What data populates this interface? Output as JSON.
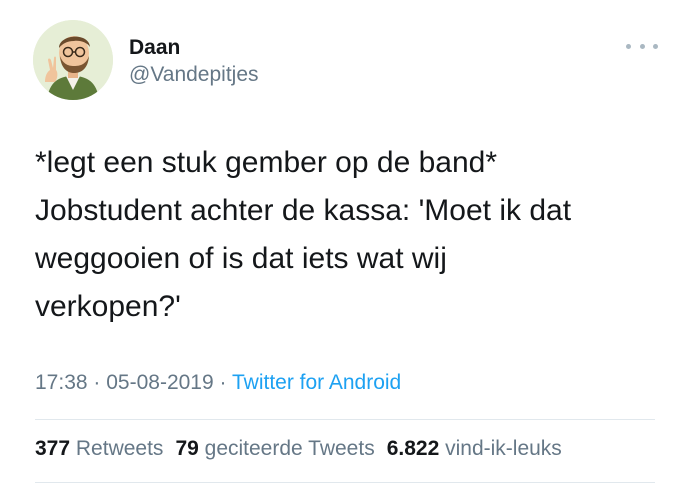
{
  "user": {
    "display_name": "Daan",
    "handle": "@Vandepitjes"
  },
  "tweet": {
    "lines": [
      "*legt een stuk gember op de band*",
      "Jobstudent achter de kassa: 'Moet ik dat",
      "weggooien of is dat iets wat wij",
      "verkopen?'"
    ]
  },
  "meta": {
    "time": "17:38",
    "separator": "·",
    "date": "05-08-2019",
    "source": "Twitter for Android"
  },
  "stats": {
    "retweets_count": "377",
    "retweets_label": "Retweets",
    "quotes_count": "79",
    "quotes_label": "geciteerde Tweets",
    "likes_count": "6.822",
    "likes_label": "vind-ik-leuks"
  },
  "icons": {
    "more": "more-options-icon",
    "avatar": "avatar"
  },
  "colors": {
    "text": "#14171a",
    "secondary": "#657786",
    "link": "#1da1f2",
    "divider": "#e1e8ed"
  }
}
